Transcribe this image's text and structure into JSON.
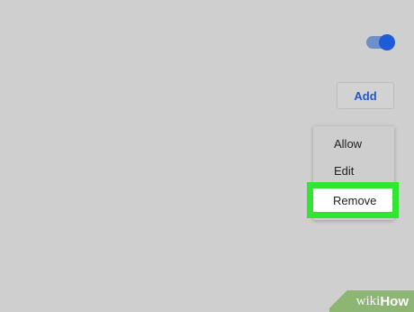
{
  "toggle": {
    "state": "on",
    "accent_color": "#1e5bd7"
  },
  "add_button": {
    "label": "Add"
  },
  "context_menu": {
    "items": [
      {
        "label": "Allow"
      },
      {
        "label": "Edit"
      },
      {
        "label": "Remove",
        "highlighted": true
      }
    ],
    "highlight_color": "#30e630"
  },
  "watermark": {
    "wiki": "wiki",
    "how": "How"
  }
}
